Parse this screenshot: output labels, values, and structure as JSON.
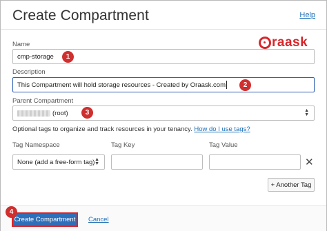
{
  "header": {
    "title": "Create Compartment",
    "help_link": "Help"
  },
  "logo": {
    "text": "raask",
    "brand_color": "#d8262b"
  },
  "form": {
    "name": {
      "label": "Name",
      "value": "cmp-storage"
    },
    "description": {
      "label": "Description",
      "value": "This Compartment will hold storage resources - Created by Oraask.com"
    },
    "parent": {
      "label": "Parent Compartment",
      "value": "(root)"
    },
    "optional_text": "Optional tags to organize and track resources in your tenancy.",
    "optional_link": "How do I use tags?"
  },
  "tags": {
    "col_namespace": "Tag Namespace",
    "col_key": "Tag Key",
    "col_value": "Tag Value",
    "namespace_value": "None (add a free-form tag)",
    "key_value": "",
    "value_value": "",
    "add_label": "+ Another Tag"
  },
  "footer": {
    "create_label": "Create Compartment",
    "cancel_label": "Cancel"
  },
  "badges": [
    "1",
    "2",
    "3",
    "4"
  ],
  "colors": {
    "accent": "#2f6eb8",
    "link": "#1d70b8",
    "badge": "#cf2f2f"
  }
}
